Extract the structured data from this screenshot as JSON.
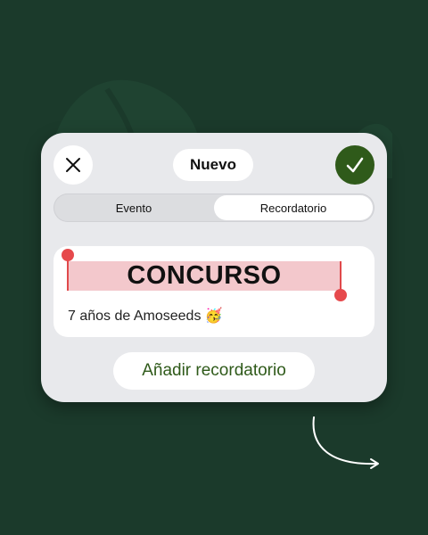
{
  "colors": {
    "background": "#1b3a2b",
    "card": "#e8e9ec",
    "accent_green": "#2f5a1a",
    "highlight": "#f3c8cc",
    "handle_red": "#e6494c"
  },
  "header": {
    "close_icon": "close-icon",
    "title": "Nuevo",
    "confirm_icon": "checkmark-icon"
  },
  "tabs": [
    {
      "label": "Evento",
      "selected": false
    },
    {
      "label": "Recordatorio",
      "selected": true
    }
  ],
  "content": {
    "highlighted_text": "CONCURSO",
    "subtitle": "7 años de Amoseeds 🥳"
  },
  "actions": {
    "add_reminder_label": "Añadir recordatorio"
  }
}
